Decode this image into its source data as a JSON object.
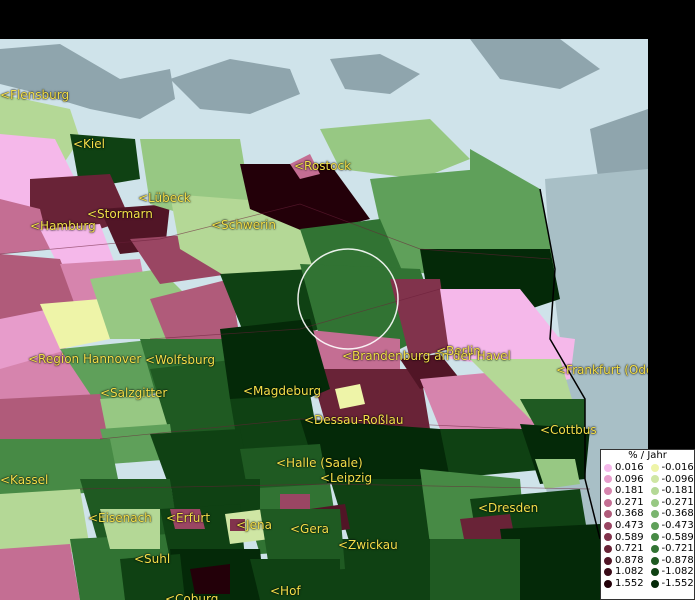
{
  "map": {
    "city_labels": [
      {
        "key": "flensburg",
        "text": "<Flensburg"
      },
      {
        "key": "kiel",
        "text": "<Kiel"
      },
      {
        "key": "luebeck",
        "text": "<Lübeck"
      },
      {
        "key": "stormarn",
        "text": "<Stormarn"
      },
      {
        "key": "hamburg",
        "text": "<Hamburg"
      },
      {
        "key": "rostock",
        "text": "<Rostock"
      },
      {
        "key": "schwerin",
        "text": "<Schwerin"
      },
      {
        "key": "berlin",
        "text": "<Berlin"
      },
      {
        "key": "brandenburg",
        "text": "<Brandenburg an der Havel"
      },
      {
        "key": "frankfurt",
        "text": "<Frankfurt (Ode"
      },
      {
        "key": "hannover",
        "text": "<Region Hannover"
      },
      {
        "key": "wolfsburg",
        "text": "<Wolfsburg"
      },
      {
        "key": "salzgitter",
        "text": "<Salzgitter"
      },
      {
        "key": "magdeburg",
        "text": "<Magdeburg"
      },
      {
        "key": "dessau",
        "text": "<Dessau-Roßlau"
      },
      {
        "key": "cottbus",
        "text": "<Cottbus"
      },
      {
        "key": "halle",
        "text": "<Halle (Saale)"
      },
      {
        "key": "leipzig",
        "text": "<Leipzig"
      },
      {
        "key": "dresden",
        "text": "<Dresden"
      },
      {
        "key": "kassel",
        "text": "<Kassel"
      },
      {
        "key": "eisenach",
        "text": "<Eisenach"
      },
      {
        "key": "erfurt",
        "text": "<Erfurt"
      },
      {
        "key": "jena",
        "text": "<Jena"
      },
      {
        "key": "gera",
        "text": "<Gera"
      },
      {
        "key": "zwickau",
        "text": "<Zwickau"
      },
      {
        "key": "suhl",
        "text": "<Suhl"
      },
      {
        "key": "coburg",
        "text": "<Coburg"
      },
      {
        "key": "hof",
        "text": "<Hof"
      }
    ]
  },
  "legend": {
    "title": "% / Jahr",
    "positive": [
      {
        "value": "0.016",
        "color": "#f5b8ea"
      },
      {
        "value": "0.096",
        "color": "#e79ccb"
      },
      {
        "value": "0.181",
        "color": "#d684ad"
      },
      {
        "value": "0.271",
        "color": "#c46e93"
      },
      {
        "value": "0.368",
        "color": "#b05b7a"
      },
      {
        "value": "0.473",
        "color": "#9a4663"
      },
      {
        "value": "0.589",
        "color": "#81334c"
      },
      {
        "value": "0.721",
        "color": "#692337"
      },
      {
        "value": "0.878",
        "color": "#511526"
      },
      {
        "value": "1.082",
        "color": "#3a0a17"
      },
      {
        "value": "1.552",
        "color": "#230009"
      }
    ],
    "negative": [
      {
        "value": "-0.016",
        "color": "#eef4a8"
      },
      {
        "value": "-0.096",
        "color": "#cfe6a4"
      },
      {
        "value": "-0.181",
        "color": "#b4d896"
      },
      {
        "value": "-0.271",
        "color": "#97c883"
      },
      {
        "value": "-0.368",
        "color": "#7ab56f"
      },
      {
        "value": "-0.473",
        "color": "#5fa05a"
      },
      {
        "value": "-0.589",
        "color": "#478a45"
      },
      {
        "value": "-0.721",
        "color": "#317333"
      },
      {
        "value": "-0.878",
        "color": "#1f5a22"
      },
      {
        "value": "-1.082",
        "color": "#0f4113"
      },
      {
        "value": "-1.552",
        "color": "#042908"
      }
    ]
  }
}
